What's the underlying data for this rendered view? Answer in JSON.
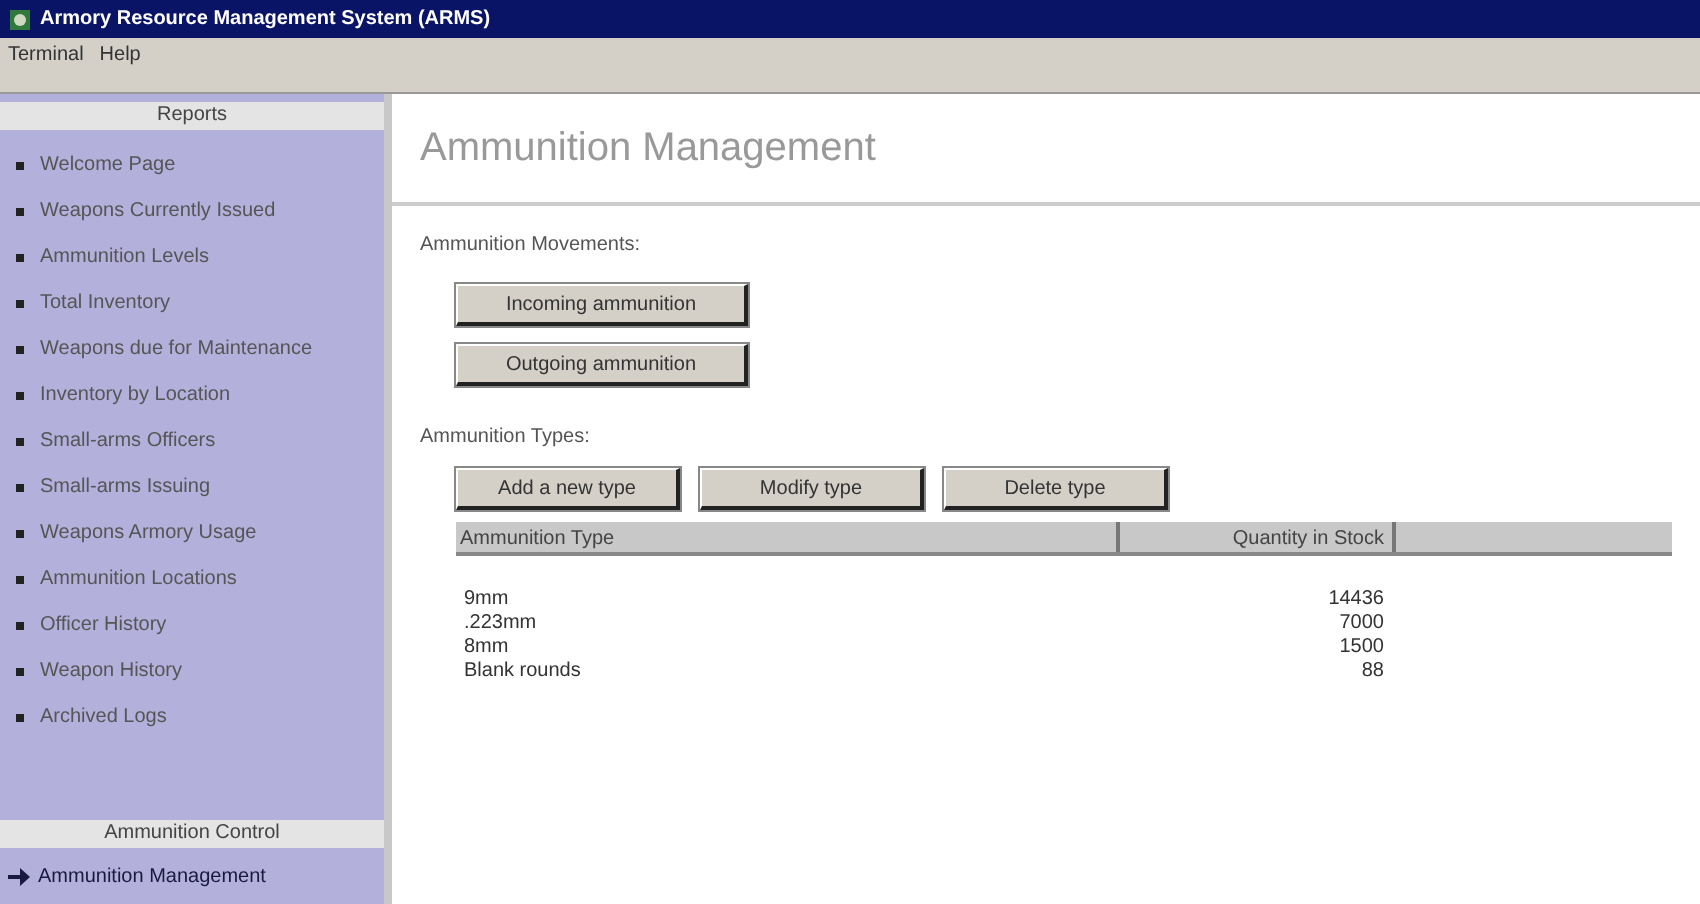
{
  "window": {
    "title": "Armory Resource Management System (ARMS)"
  },
  "menu": [
    "Terminal",
    "Help"
  ],
  "sidebar": {
    "reports_header": "Reports",
    "reports": [
      {
        "label": "Welcome Page"
      },
      {
        "label": "Weapons Currently Issued"
      },
      {
        "label": "Ammunition Levels"
      },
      {
        "label": "Total Inventory"
      },
      {
        "label": "Weapons due for Maintenance"
      },
      {
        "label": "Inventory by Location"
      },
      {
        "label": "Small-arms Officers"
      },
      {
        "label": "Small-arms Issuing"
      },
      {
        "label": "Weapons Armory Usage"
      },
      {
        "label": "Ammunition Locations"
      },
      {
        "label": "Officer History"
      },
      {
        "label": "Weapon History"
      },
      {
        "label": "Archived Logs"
      }
    ],
    "control_header": "Ammunition Control",
    "control": [
      {
        "label": "Ammunition Management",
        "selected": true
      }
    ]
  },
  "main": {
    "title": "Ammunition Management",
    "movements_label": "Ammunition Movements:",
    "movement_buttons": [
      "Incoming ammunition",
      "Outgoing ammunition"
    ],
    "types_label": "Ammunition Types:",
    "type_buttons": [
      "Add a new type",
      "Modify type",
      "Delete type"
    ],
    "table": {
      "columns": [
        "Ammunition Type",
        "Quantity in Stock"
      ],
      "rows": [
        [
          "9mm",
          "14436"
        ],
        [
          ".223mm",
          "7000"
        ],
        [
          "8mm",
          "1500"
        ],
        [
          "Blank rounds",
          "88"
        ]
      ]
    }
  }
}
